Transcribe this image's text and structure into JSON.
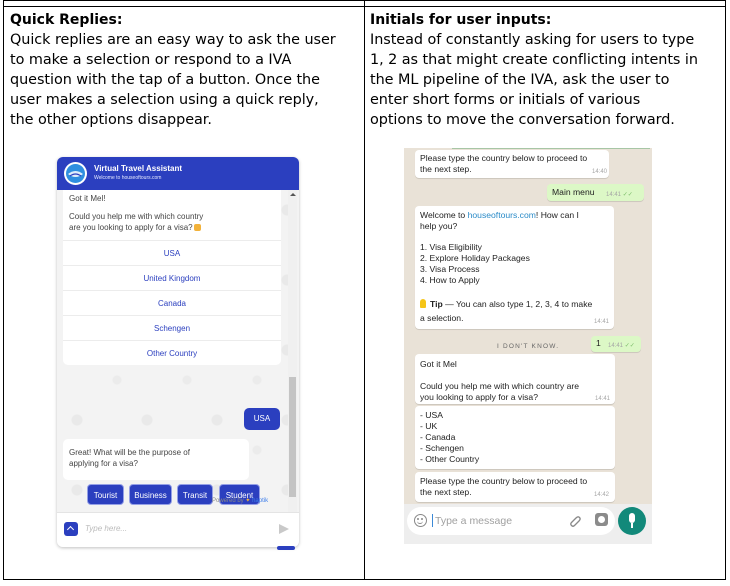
{
  "left": {
    "heading": "Quick Replies:",
    "paragraph_lines": [
      "Quick replies are an easy way to ask the user",
      "to make a selection or respond to a IVA",
      "question with the tap of a button. Once the",
      "user makes a selection using a quick reply,",
      "the other options disappear."
    ],
    "widget": {
      "title": "Virtual Travel Assistant",
      "subtitle": "Welcome to houseoftours.com",
      "greeting": "Got it Mel!",
      "question_lines": [
        "Could you help me with which country",
        "are you looking to apply for a visa?"
      ],
      "options": [
        "USA",
        "United Kingdom",
        "Canada",
        "Schengen",
        "Other Country"
      ],
      "user_reply": "USA",
      "followup_lines": [
        "Great! What will be the purpose of",
        "applying for a visa?"
      ],
      "chips": [
        "Tourist",
        "Business",
        "Transit",
        "Student"
      ],
      "powered_by": "Powered by",
      "brand": "haptik",
      "input_placeholder": "Type here..."
    }
  },
  "right": {
    "heading": "Initials for user inputs:",
    "paragraph_lines": [
      "Instead of constantly asking for users to type",
      "1, 2 as that might create conflicting intents in",
      "the ML pipeline of the IVA, ask the user to",
      "enter short forms or initials of various",
      "options to move the conversation forward."
    ],
    "chat": {
      "top_lines": [
        "Please type the country below to proceed to",
        "the next step."
      ],
      "top_time": "14:40",
      "main_menu": "Main menu",
      "main_menu_time": "14:41",
      "welcome_prefix": "Welcome to ",
      "welcome_link": "houseoftours.com",
      "welcome_suffix": "! How can I",
      "welcome_line2": "help you?",
      "menu_items": [
        "1. Visa Eligibility",
        "2. Explore Holiday Packages",
        "3. Visa Process",
        "4. How to Apply"
      ],
      "tip_label": "Tip",
      "tip_text": " — You can also type 1, 2, 3, 4 to make",
      "tip_line2": "a selection.",
      "welcome_time": "14:41",
      "dont_know": "I DON'T KNOW.",
      "user_one": "1",
      "user_one_time": "14:41",
      "got_it": "Got it Mel",
      "question_lines": [
        "Could you help me with which country are",
        "you looking to apply for a visa?"
      ],
      "question_time": "14:41",
      "country_list": [
        "- USA",
        "- UK",
        "- Canada",
        "- Schengen",
        "- Other Country"
      ],
      "proceed_lines": [
        "Please type the country below to proceed to",
        "the next step."
      ],
      "proceed_time": "14:42",
      "input_placeholder": "Type a message"
    }
  },
  "colors": {
    "widget_blue": "#2b3fbf",
    "whatsapp_green": "#12897a",
    "outgoing_bubble": "#dcf8c6",
    "chat_background": "#e9e2d7"
  }
}
